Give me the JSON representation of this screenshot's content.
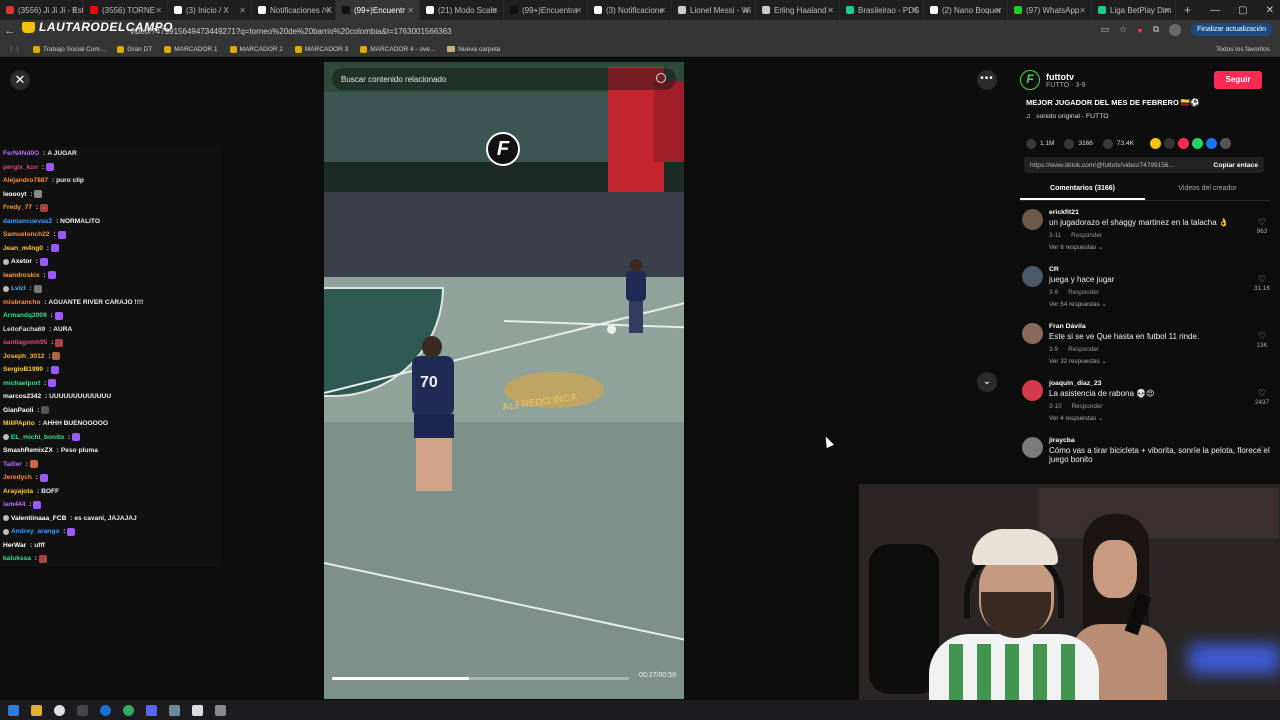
{
  "watermark": {
    "text": "LAUTARODELCAMPO"
  },
  "browser": {
    "tabs": [
      {
        "label": "(3556) Ji Ji Ji - Est",
        "color": "#d33"
      },
      {
        "label": "(3556) TORNE",
        "color": "#f00"
      },
      {
        "label": "(3) Inicio / X",
        "color": "#fff"
      },
      {
        "label": "Notificaciones / X",
        "color": "#fff"
      },
      {
        "label": "(99+)Encuentr",
        "color": "#111",
        "active": true
      },
      {
        "label": "(21) Modo Scalo",
        "color": "#fff"
      },
      {
        "label": "(99+)Encuentra",
        "color": "#111"
      },
      {
        "label": "(3) Notificacione",
        "color": "#fff"
      },
      {
        "label": "Lionel Messi - Wi",
        "color": "#ccc"
      },
      {
        "label": "Erling Haaland -",
        "color": "#ccc"
      },
      {
        "label": "Brasileirao - PDS",
        "color": "#2c8"
      },
      {
        "label": "(2) Nano Boquer",
        "color": "#fff"
      },
      {
        "label": "(97) WhatsApp",
        "color": "#2c2"
      },
      {
        "label": "Liga BetPlay Dim",
        "color": "#2c8"
      }
    ],
    "url": "video/7479915649473449271?q=torneo%20de%20barrio%20colombia&t=1763001566363",
    "update_label": "Finalizar actualización",
    "bookmarks": [
      "Trabajo Social Com...",
      "Gran DT",
      "MARCADOR 1",
      "MARCADOR 2",
      "MARCADOR 3",
      "MARCADOR 4 - ove...",
      "Nueva carpeta"
    ],
    "all_bookmarks": "Todos los favoritos"
  },
  "chat": [
    {
      "user": "FerN4Nd0O",
      "msg": "A JUGAR",
      "color": "#b96cff"
    },
    {
      "user": "pergix_kun",
      "msg": "",
      "color": "#e0457b",
      "emote": "#9b59ff"
    },
    {
      "user": "Alejandro7887",
      "msg": "puro clip",
      "color": "#ff8c3a"
    },
    {
      "user": "leoooyt",
      "msg": "",
      "color": "#ffffff",
      "emote": "#888"
    },
    {
      "user": "Fredy_77",
      "msg": "",
      "color": "#ff9a3a",
      "emote": "#a44"
    },
    {
      "user": "damiancuevas2",
      "msg": "NORMALITO",
      "color": "#3aa0ff"
    },
    {
      "user": "Samuelonch22",
      "msg": "",
      "color": "#ff8c3a",
      "emote": "#9b59ff"
    },
    {
      "user": "Jean_m4ng0",
      "msg": "",
      "color": "#ffcc33",
      "emote": "#9b59ff"
    },
    {
      "user": "Axetor",
      "msg": "",
      "color": "#ffffff",
      "emote": "#9b59ff",
      "badge": true
    },
    {
      "user": "leandroskix",
      "msg": "",
      "color": "#ff9a3a",
      "emote": "#9b59ff"
    },
    {
      "user": "Lvizl",
      "msg": "",
      "color": "#4fb0ff",
      "emote": "#777",
      "badge": true
    },
    {
      "user": "misbrancho",
      "msg": "AGUANTE RIVER CARAJO !!!!",
      "color": "#ff8c3a"
    },
    {
      "user": "Armandq2009",
      "msg": "",
      "color": "#3adf8a",
      "emote": "#9b59ff"
    },
    {
      "user": "LeitoFacha69",
      "msg": "AURA",
      "color": "#dddddd"
    },
    {
      "user": "santiagomh95",
      "msg": "",
      "color": "#e0457b",
      "emote": "#a44"
    },
    {
      "user": "Joseph_3012",
      "msg": "",
      "color": "#ffb030",
      "emote": "#a64"
    },
    {
      "user": "SergioB1999",
      "msg": "",
      "color": "#ffcc33",
      "emote": "#9b59ff"
    },
    {
      "user": "michaelport",
      "msg": "",
      "color": "#3adf8a",
      "emote": "#9b59ff"
    },
    {
      "user": "marcos2342",
      "msg": "UUUUUUUUUUUUU",
      "color": "#ffffff"
    },
    {
      "user": "GianPaoli",
      "msg": "",
      "color": "#ffffff",
      "emote": "#555"
    },
    {
      "user": "MillPApito",
      "msg": "AHHH BUENOOOOO",
      "color": "#ffcc33"
    },
    {
      "user": "EL_michi_bonito",
      "msg": "",
      "color": "#3adf8a",
      "emote": "#9b59ff",
      "badge": true
    },
    {
      "user": "SmashRemixZX",
      "msg": "Peso pluma",
      "color": "#ffffff"
    },
    {
      "user": "Tailler",
      "msg": "",
      "color": "#b96cff",
      "emote": "#c64"
    },
    {
      "user": "Jeredych",
      "msg": "",
      "color": "#ff8c3a",
      "emote": "#9b59ff"
    },
    {
      "user": "Arayajota",
      "msg": "BOFF",
      "color": "#ffcc33"
    },
    {
      "user": "iam444",
      "msg": "",
      "color": "#b96cff",
      "emote": "#9b59ff"
    },
    {
      "user": "Valentiinaaa_FCB",
      "msg": "es cavani, JAJAJAJ",
      "color": "#ffffff",
      "badge": true
    },
    {
      "user": "Andrey_arango",
      "msg": "",
      "color": "#3aa0ff",
      "emote": "#9b59ff",
      "badge": true
    },
    {
      "user": "HerWar",
      "msg": "ufff",
      "color": "#ffffff"
    },
    {
      "user": "kalukssa",
      "msg": "",
      "color": "#3adf8a",
      "emote": "#a44"
    }
  ],
  "video": {
    "search_placeholder": "Buscar contenido relacionado",
    "time": "00:27/00:59",
    "progress_fraction": 0.46,
    "jersey_number": "70",
    "floor_text": "ALFREDO INCA",
    "logo_letter": "F"
  },
  "panel": {
    "author_initial": "F",
    "author_name": "futtotv",
    "author_sub": "FUTTO · 3-9",
    "follow_label": "Seguir",
    "caption": "MEJOR JUGADOR DEL MES DE FEBRERO 🇨🇴⚽",
    "sound": "sonido original - FUTTO",
    "likes": "1.1M",
    "comments_count": "3166",
    "saves": "73.4K",
    "link": "https://www.tiktok.com/@futtotv/video/74799156...",
    "copy_label": "Copiar enlace",
    "tab_comments": "Comentarios (3166)",
    "tab_creator": "Videos del creador",
    "comments": [
      {
        "user": "erickfit21",
        "text": "un jugadorazo el shaggy martinez en la talacha 👌",
        "date": "3-11",
        "reply": "Responder",
        "replies": "Ver 6 respuestas",
        "likes": "963",
        "color": "#6b5a4a"
      },
      {
        "user": "CR",
        "text": "juega y hace jugar",
        "date": "3-9",
        "reply": "Responder",
        "replies": "Ver 54 respuestas",
        "likes": "31.1K",
        "color": "#4a5a6a"
      },
      {
        "user": "Fran Dávila",
        "text": "Este si se ve Que hasta en futbol 11 rinde.",
        "date": "3-9",
        "reply": "Responder",
        "replies": "Ver 32 respuestas",
        "likes": "13K",
        "color": "#8a6a5a"
      },
      {
        "user": "joaquin_diaz_23",
        "text": "La asistencia de rabona 💀😍",
        "date": "3-10",
        "reply": "Responder",
        "replies": "Ver 4 respuestas",
        "likes": "2437",
        "color": "#d43a4a"
      },
      {
        "user": "jiraycba",
        "text": "Cómo vas a tirar bicicleta + viborita, sonríe la pelota, florece el juego bonito",
        "date": "",
        "reply": "",
        "replies": "",
        "likes": "",
        "color": "#7a7a7a"
      }
    ]
  }
}
